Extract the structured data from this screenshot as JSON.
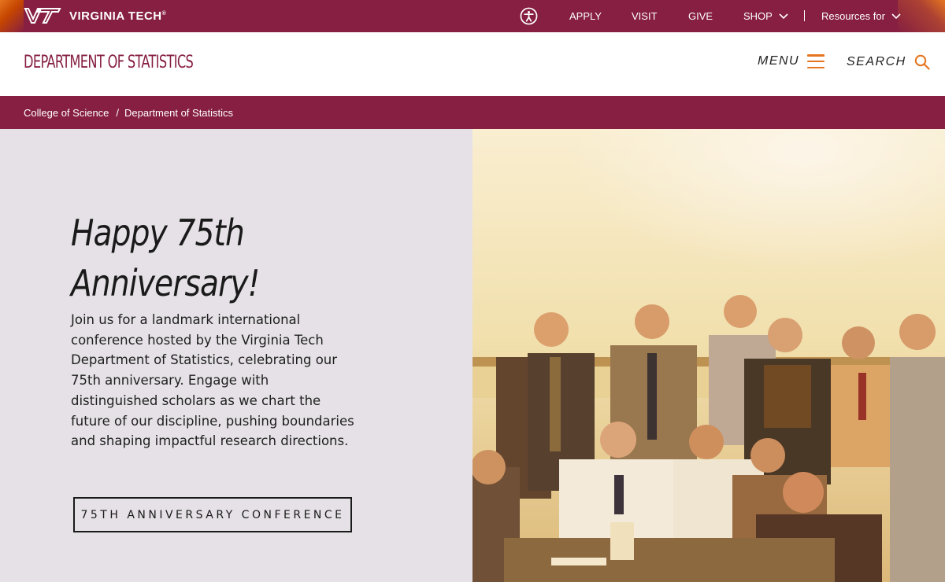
{
  "topbar": {
    "brand": "VIRGINIA TECH",
    "brand_mark": "®",
    "links": [
      {
        "label": "APPLY"
      },
      {
        "label": "VISIT"
      },
      {
        "label": "GIVE"
      },
      {
        "label": "SHOP"
      }
    ],
    "resources_label": "Resources for",
    "icons": [
      "vt-logo-icon",
      "accessibility-icon",
      "chevron-down-icon"
    ],
    "colors": {
      "maroon": "#861f41",
      "orange": "#e5751f"
    }
  },
  "header": {
    "title": "DEPARTMENT OF STATISTICS",
    "menu_label": "MENU",
    "search_label": "SEARCH",
    "icons": [
      "hamburger-menu-icon",
      "search-icon"
    ]
  },
  "breadcrumb": {
    "items": [
      "College of Science",
      "Department of Statistics"
    ],
    "separator": "/"
  },
  "hero": {
    "heading_line1": "Happy 75th",
    "heading_line2": "Anniversary!",
    "body": "Join us for a landmark international conference hosted by the Virginia Tech Department of Statistics, celebrating our 75th anniversary. Engage with distinguished scholars as we chart the future of our discipline, pushing boundaries and shaping impactful research directions.",
    "cta_label": "75TH ANNIVERSARY CONFERENCE",
    "image": "vintage-department-group-photo"
  }
}
